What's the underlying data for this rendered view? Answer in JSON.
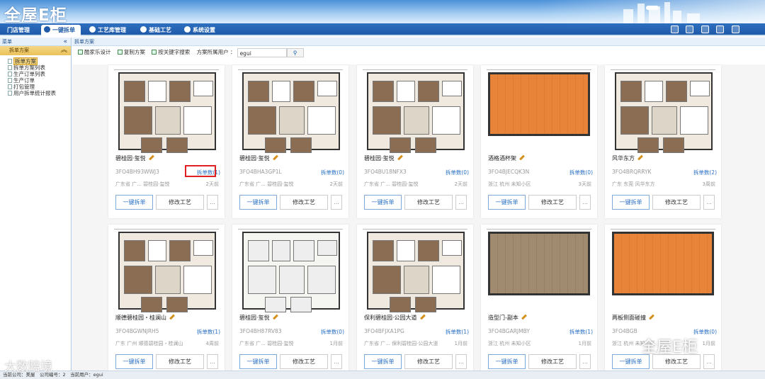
{
  "app": {
    "logo": "全屋E柜"
  },
  "nav": {
    "tabs": [
      {
        "label": "门店管理"
      },
      {
        "label": "一键拆单"
      },
      {
        "label": "工艺库管理"
      },
      {
        "label": "基础工艺"
      },
      {
        "label": "系统设置"
      }
    ],
    "tool_icons": [
      "monitor-icon",
      "lock-icon",
      "user-icon",
      "gear-icon",
      "exit-icon"
    ]
  },
  "sidebar": {
    "header": "菜单",
    "section": "拆单方案",
    "items": [
      "拆单方案",
      "拆单方案列表",
      "生产订单列表",
      "生产订单",
      "打包管理",
      "用户拆单统计报表"
    ]
  },
  "breadcrumb": "拆单方案",
  "toolbar": {
    "design": "酷家乐设计",
    "copy": "复制方案",
    "search_label": "按关键字搜索",
    "owner_label": "方案所属用户 ：",
    "owner_value": "egui"
  },
  "card_labels": {
    "split": "一键拆单",
    "modify": "修改工艺",
    "more": "..."
  },
  "cards": [
    {
      "title": "碧桂园·玺悦",
      "code": "3FO4BH93WWJ3",
      "count": "拆单数(1)",
      "loc": "广东省 广... 碧桂园·玺悦",
      "time": "2天前"
    },
    {
      "title": "碧桂园·玺悦",
      "code": "3FO4BHA3GP1L",
      "count": "拆单数(0)",
      "loc": "广东省 广... 碧桂园·玺悦",
      "time": "2天前"
    },
    {
      "title": "碧桂园·玺悦",
      "code": "3FO4BU18NFX3",
      "count": "拆单数(0)",
      "loc": "广东省 广... 碧桂园·玺悦",
      "time": "2天前"
    },
    {
      "title": "酒格酒杯架",
      "code": "3FO4BJECQK3N",
      "count": "拆单数(0)",
      "loc": "浙江 杭州 未知小区",
      "time": "3天前"
    },
    {
      "title": "风华东方",
      "code": "3FO4BRQRRYK",
      "count": "拆单数(2)",
      "loc": "广东 东莞 风华东方",
      "time": "3周前"
    },
    {
      "title": "顺德碧桂园・桂澜山",
      "code": "3FO4BGWNJRH5",
      "count": "拆单数(1)",
      "loc": "广东 广州 顺德碧桂园・桂澜山",
      "time": "4周前"
    },
    {
      "title": "碧桂园·玺悦",
      "code": "3FO4BH87RV83",
      "count": "拆单数(0)",
      "loc": "广东省 广... 碧桂园·玺悦",
      "time": "1月前"
    },
    {
      "title": "保利碧桂园·公园大道",
      "code": "3FO4BFJXA1PG",
      "count": "拆单数(1)",
      "loc": "广东省 广... 保利碧桂园·公园大道",
      "time": "1月前"
    },
    {
      "title": "造型门-副本",
      "code": "3FO4BGARJMBY",
      "count": "拆单数(1)",
      "loc": "浙江 杭州 未知小区",
      "time": "1月前"
    },
    {
      "title": "两板侧面碰撞",
      "code": "3FO4BGB",
      "count": "拆单数(0)",
      "loc": "浙江 杭州 未知小区",
      "time": "1月前"
    }
  ],
  "status": {
    "text": "当前公司：美屋　公司编号：2　当前用户：egui"
  },
  "watermarks": {
    "left": "大数陪境",
    "right": "全屋E柜"
  },
  "colors": {
    "nav": "#1f5aa8",
    "link": "#2a70c4",
    "highlight": "#e02020",
    "floor": "#e8833a"
  }
}
